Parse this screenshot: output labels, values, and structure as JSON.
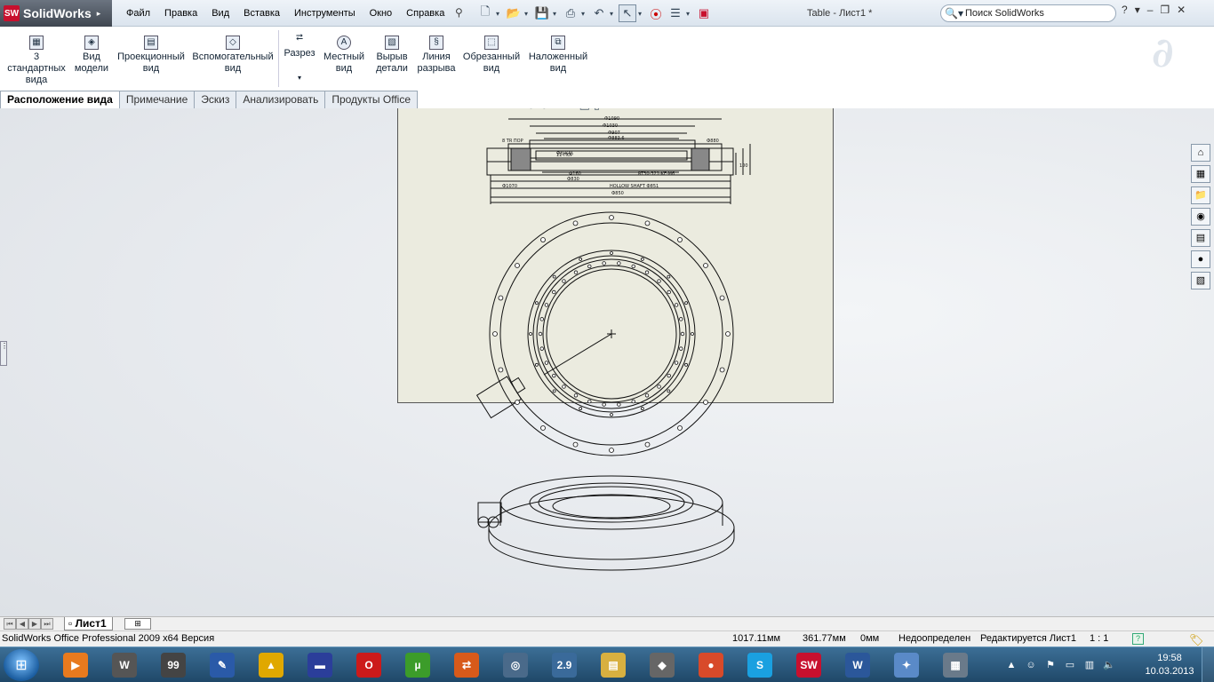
{
  "app": {
    "logo_mark": "SW",
    "logo_text": "SolidWorks",
    "window_title": "Table - Лист1 *"
  },
  "menu": [
    "Файл",
    "Правка",
    "Вид",
    "Вставка",
    "Инструменты",
    "Окно",
    "Справка"
  ],
  "search": {
    "placeholder": "Поиск SolidWorks"
  },
  "commands": [
    {
      "label": "3 стандартных вида",
      "icon": "three-standard-views-icon"
    },
    {
      "label": "Вид модели",
      "icon": "model-view-icon"
    },
    {
      "label": "Проекционный вид",
      "icon": "projected-view-icon"
    },
    {
      "label": "Вспомогательный вид",
      "icon": "auxiliary-view-icon"
    },
    {
      "label": "Разрез",
      "icon": "section-view-icon"
    },
    {
      "label": "Местный вид",
      "icon": "detail-view-icon"
    },
    {
      "label": "Вырыв детали",
      "icon": "broken-out-section-icon"
    },
    {
      "label": "Линия разрыва",
      "icon": "break-line-icon"
    },
    {
      "label": "Обрезанный вид",
      "icon": "crop-view-icon"
    },
    {
      "label": "Наложенный вид",
      "icon": "alternate-position-view-icon"
    }
  ],
  "tabs": [
    "Расположение вида",
    "Примечание",
    "Эскиз",
    "Анализировать",
    "Продукты Office"
  ],
  "drawing": {
    "dims": [
      "Ф1090",
      "Ф1030",
      "Ф907",
      "Ф883.6",
      "8 TR ПОР",
      "Ф880",
      "11-ПОР",
      "Ф8ПОР",
      "Ф160",
      "Ф830",
      "RT30-321-KF-M6",
      "HOLLOW SHAFT Ф851",
      "Ф850",
      "Ф1070",
      "100"
    ]
  },
  "sheet_tab": "Лист1",
  "status": {
    "product": "SolidWorks Office Professional 2009 x64 Версия",
    "x": "1017.11мм",
    "y": "361.77мм",
    "z": "0мм",
    "state": "Недоопределен",
    "editing": "Редактируется Лист1",
    "scale": "1 : 1"
  },
  "taskbar": {
    "apps": [
      {
        "name": "media-player",
        "glyph": "▶",
        "color": "#e87a1e"
      },
      {
        "name": "world-of-tanks",
        "glyph": "W",
        "color": "#555555"
      },
      {
        "name": "monitor-99",
        "glyph": "99",
        "color": "#444444"
      },
      {
        "name": "graphics-app",
        "glyph": "✎",
        "color": "#2a5aa8"
      },
      {
        "name": "archicad",
        "glyph": "▲",
        "color": "#e0a800"
      },
      {
        "name": "save-disk",
        "glyph": "▬",
        "color": "#2b3e9a"
      },
      {
        "name": "opera",
        "glyph": "O",
        "color": "#cc1a1a"
      },
      {
        "name": "utorrent",
        "glyph": "µ",
        "color": "#3c9c2a"
      },
      {
        "name": "sync-app",
        "glyph": "⇄",
        "color": "#d85a1a"
      },
      {
        "name": "globe-app",
        "glyph": "◎",
        "color": "#4a6a8a"
      },
      {
        "name": "city-info",
        "glyph": "2.9",
        "color": "#3a6a9a"
      },
      {
        "name": "file-explorer",
        "glyph": "▤",
        "color": "#d8b040"
      },
      {
        "name": "inkscape",
        "glyph": "◆",
        "color": "#666666"
      },
      {
        "name": "chrome",
        "glyph": "●",
        "color": "#d84a2a"
      },
      {
        "name": "skype",
        "glyph": "S",
        "color": "#1aa0e0"
      },
      {
        "name": "solidworks",
        "glyph": "SW",
        "color": "#c8102e"
      },
      {
        "name": "word",
        "glyph": "W",
        "color": "#2b579a"
      },
      {
        "name": "paint",
        "glyph": "✦",
        "color": "#5a8ac8"
      },
      {
        "name": "calculator",
        "glyph": "▦",
        "color": "#6a7a8a"
      }
    ],
    "time": "19:58",
    "date": "10.03.2013"
  }
}
